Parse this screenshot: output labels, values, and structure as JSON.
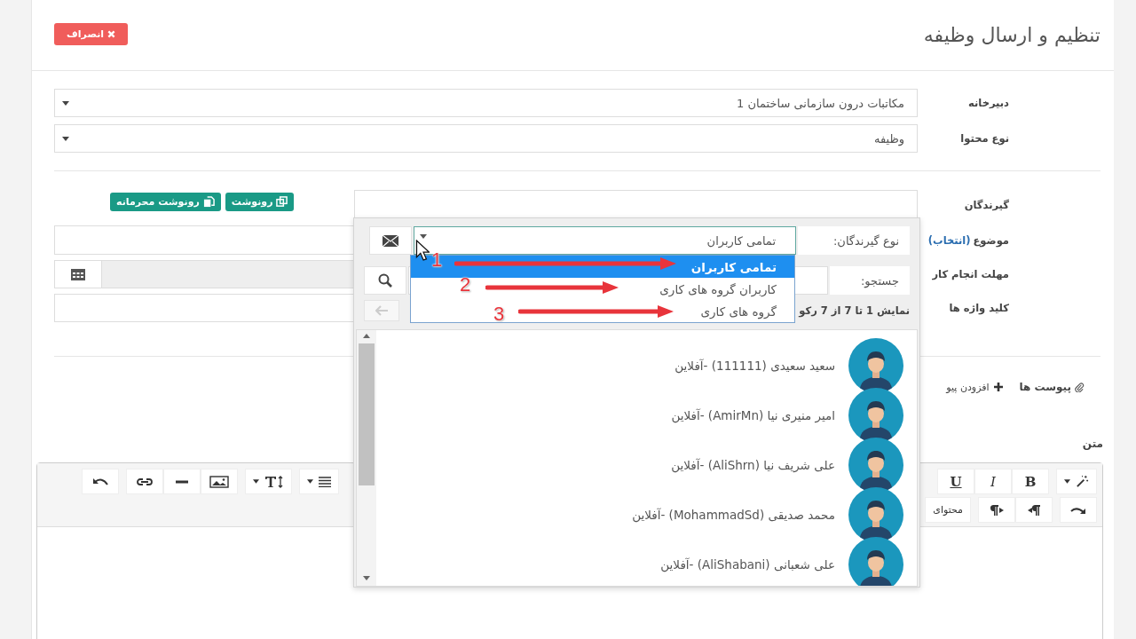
{
  "header": {
    "title": "تنظیم و ارسال وظیفه",
    "cancel_button": "انصراف"
  },
  "fields": [
    {
      "label": "دبیرخانه",
      "value": "مکاتبات درون سازمانی ساختمان 1"
    },
    {
      "label": "نوع محتوا",
      "value": "وظیفه"
    }
  ],
  "recipients": {
    "label": "گیرندگان",
    "buttons": [
      {
        "label": "رونوشت",
        "kind": "copy"
      },
      {
        "label": "رونوشت محرمانه",
        "kind": "secret"
      }
    ]
  },
  "subject": {
    "label": "موضوع",
    "link": "(انتخاب)"
  },
  "deadline": {
    "label": "مهلت انجام کار"
  },
  "keywords": {
    "label": "کلید واژه ها"
  },
  "attachments": {
    "label": "پیوست ها",
    "add": "افزودن پیو"
  },
  "body": {
    "label": "متن",
    "row1_right": [
      [
        {
          "kind": "wand"
        }
      ],
      [
        {
          "kind": "bold",
          "label": "B"
        },
        {
          "kind": "italic",
          "label": "I"
        },
        {
          "kind": "underline",
          "label": "U"
        }
      ]
    ],
    "row1_left": [
      [
        {
          "kind": "align"
        }
      ],
      [
        {
          "kind": "fontsize"
        }
      ],
      [
        {
          "kind": "image"
        },
        {
          "kind": "rule"
        },
        {
          "kind": "link"
        }
      ],
      [
        {
          "kind": "undo"
        }
      ]
    ],
    "row2_right": [
      [
        {
          "kind": "redo"
        }
      ],
      [
        {
          "kind": "rtl"
        },
        {
          "kind": "ltr"
        }
      ],
      [
        {
          "kind": "content",
          "label": "محتوای"
        }
      ]
    ]
  },
  "picker": {
    "type_label": "نوع گیرندگان:",
    "type_value": "تمامی کاربران",
    "search_label": "جستجو:",
    "info": "نمایش 1 تا 7 از 7 رکو",
    "options": [
      {
        "label": "تمامی کاربران",
        "selected": true
      },
      {
        "label": "کاربران گروه های کاری",
        "selected": false
      },
      {
        "label": "گروه های کاری",
        "selected": false
      }
    ],
    "users": [
      {
        "name": "سعید سعیدی (111111) -آفلاین"
      },
      {
        "name": "امیر منیری نیا (AmirMn) -آفلاین"
      },
      {
        "name": "علی شریف نیا (AliShrn) -آفلاین"
      },
      {
        "name": "محمد صدیقی (MohammadSd) -آفلاین"
      },
      {
        "name": "علی شعبانی (AliShabani) -آفلاین"
      }
    ]
  },
  "annotations": [
    {
      "number": "1"
    },
    {
      "number": "2"
    },
    {
      "number": "3"
    }
  ]
}
